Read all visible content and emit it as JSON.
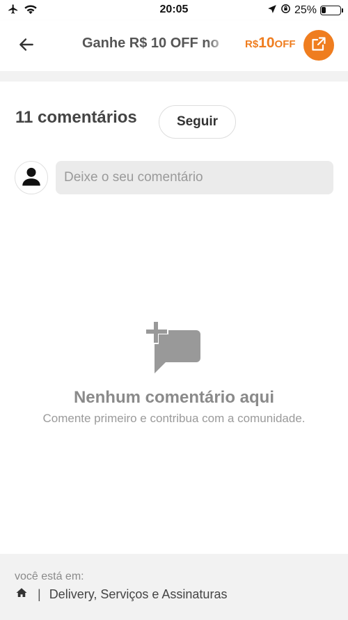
{
  "status_bar": {
    "time": "20:05",
    "battery_text": "25%",
    "battery_level": 0.25,
    "icons": [
      "airplane-icon",
      "wifi-icon",
      "location-icon",
      "orientation-lock-icon",
      "battery-icon"
    ]
  },
  "header": {
    "title": "Ganhe R$ 10 OFF no",
    "promo_currency": "R$",
    "promo_amount": "10",
    "promo_suffix": "OFF",
    "accent_color": "#ef7d1f"
  },
  "comments": {
    "count_label": "11 comentários",
    "follow_label": "Seguir",
    "input_placeholder": "Deixe o seu comentário"
  },
  "empty_state": {
    "icon": "add-comment-icon",
    "title": "Nenhum comentário aqui",
    "subtitle": "Comente primeiro e contribua com a comunidade."
  },
  "footer": {
    "label": "você está em:",
    "separator": "|",
    "breadcrumb": "Delivery, Serviços e Assinaturas"
  }
}
